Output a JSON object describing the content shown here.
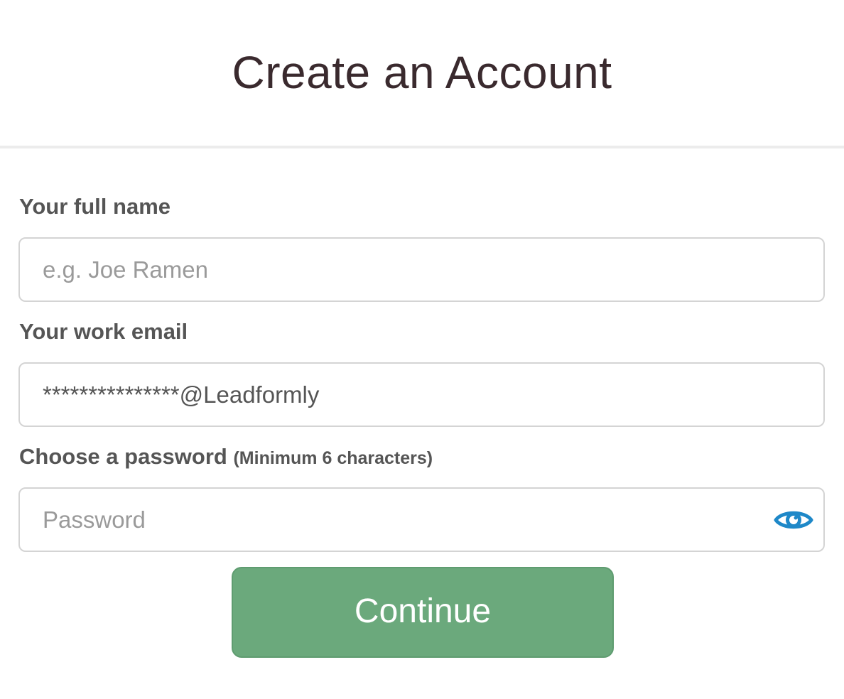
{
  "header": {
    "title": "Create an Account"
  },
  "form": {
    "full_name": {
      "label": "Your full name",
      "value": "",
      "placeholder": "e.g. Joe Ramen"
    },
    "email": {
      "label": "Your work email",
      "value": "***************@Leadformly",
      "placeholder": ""
    },
    "password": {
      "label": "Choose a password",
      "hint": "(Minimum 6 characters)",
      "value": "",
      "placeholder": "Password",
      "toggle_icon": "eye-icon"
    },
    "submit_label": "Continue"
  },
  "colors": {
    "title": "#3a2a2e",
    "label": "#555555",
    "button": "#6ba97c",
    "eye_icon": "#1e88c8"
  }
}
